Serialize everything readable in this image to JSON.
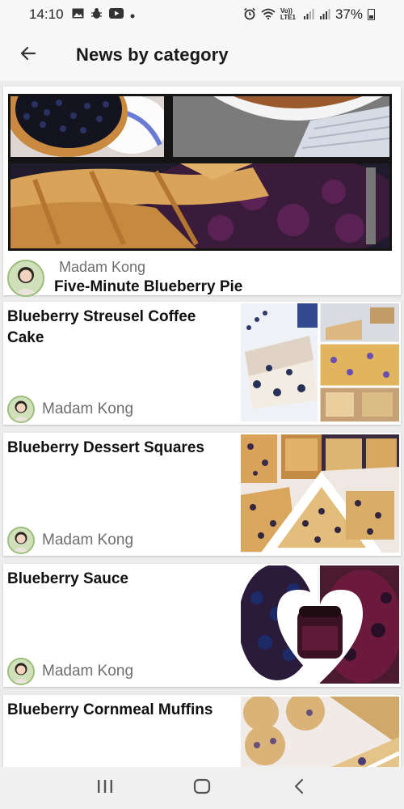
{
  "status_bar": {
    "time": "14:10",
    "network": "Vo)) LTE1",
    "battery": "37%"
  },
  "app_bar": {
    "title": "News by category"
  },
  "hero": {
    "author": "Madam Kong",
    "title": "Five-Minute Blueberry Pie"
  },
  "articles": [
    {
      "title": "Blueberry Streusel Coffee Cake",
      "author": "Madam Kong"
    },
    {
      "title": "Blueberry Dessert Squares",
      "author": "Madam Kong"
    },
    {
      "title": "Blueberry Sauce",
      "author": "Madam Kong"
    },
    {
      "title": "Blueberry Cornmeal Muffins"
    }
  ],
  "colors": {
    "background": "#ececec",
    "card": "#ffffff",
    "author_text": "#6e6e6e",
    "title_text": "#111111"
  },
  "icons": {
    "back": "arrow-left-icon",
    "nav_recents": "recents-icon",
    "nav_home": "home-icon",
    "nav_back": "back-chevron-icon"
  }
}
